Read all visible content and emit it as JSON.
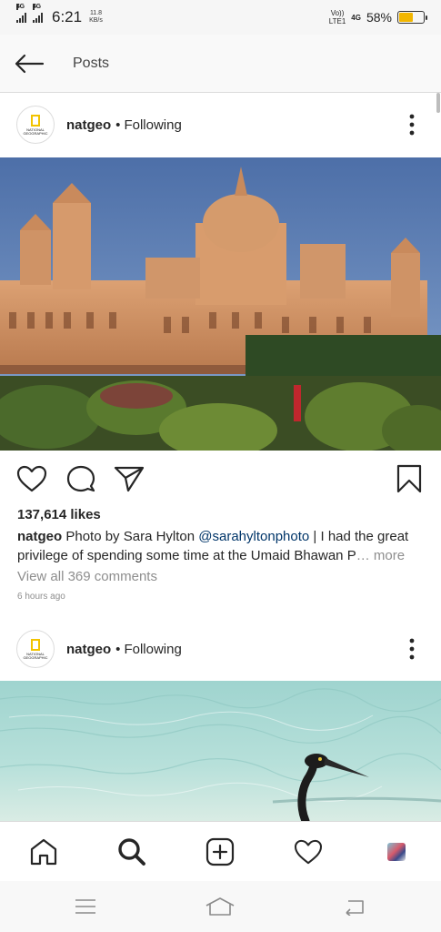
{
  "status_bar": {
    "sim1": "4G",
    "sim2": "4G",
    "time": "6:21",
    "net_speed_value": "11.8",
    "net_speed_unit": "KB/s",
    "volte_top": "Vo))",
    "volte_bottom": "LTE1",
    "lte_small": "4G",
    "battery_percent": "58%",
    "battery_level": 0.58,
    "battery_color": "#f2b600"
  },
  "header": {
    "title": "Posts"
  },
  "posts": [
    {
      "username": "natgeo",
      "dot": "•",
      "following": "Following",
      "avatar_text": "NATIONAL GEOGRAPHIC",
      "likes": "137,614 likes",
      "caption_user": "natgeo",
      "caption_text_1": "Photo by Sara Hylton",
      "caption_mention": "@sarahyltonphoto",
      "caption_text_2": "| I had the great privilege of spending some time at the Umaid Bhawan P",
      "caption_ellipsis": "…",
      "more_label": "more",
      "view_comments": "View all 369 comments",
      "time_ago": "6 hours ago"
    },
    {
      "username": "natgeo",
      "dot": "•",
      "following": "Following",
      "avatar_text": "NATIONAL GEOGRAPHIC"
    }
  ],
  "icons": {
    "back": "back-arrow-icon",
    "more": "more-vertical-icon",
    "like": "heart-icon",
    "comment": "comment-icon",
    "share": "send-icon",
    "save": "bookmark-icon",
    "home": "home-icon",
    "search": "search-icon",
    "add": "add-post-icon",
    "activity": "heart-icon",
    "profile": "profile-avatar",
    "sys_menu": "menu-icon",
    "sys_home": "home-outline-icon",
    "sys_back": "return-icon"
  },
  "colors": {
    "mention": "#003569",
    "muted": "#8e8e8e",
    "text": "#262626",
    "natgeo_yellow": "#f2c300"
  }
}
